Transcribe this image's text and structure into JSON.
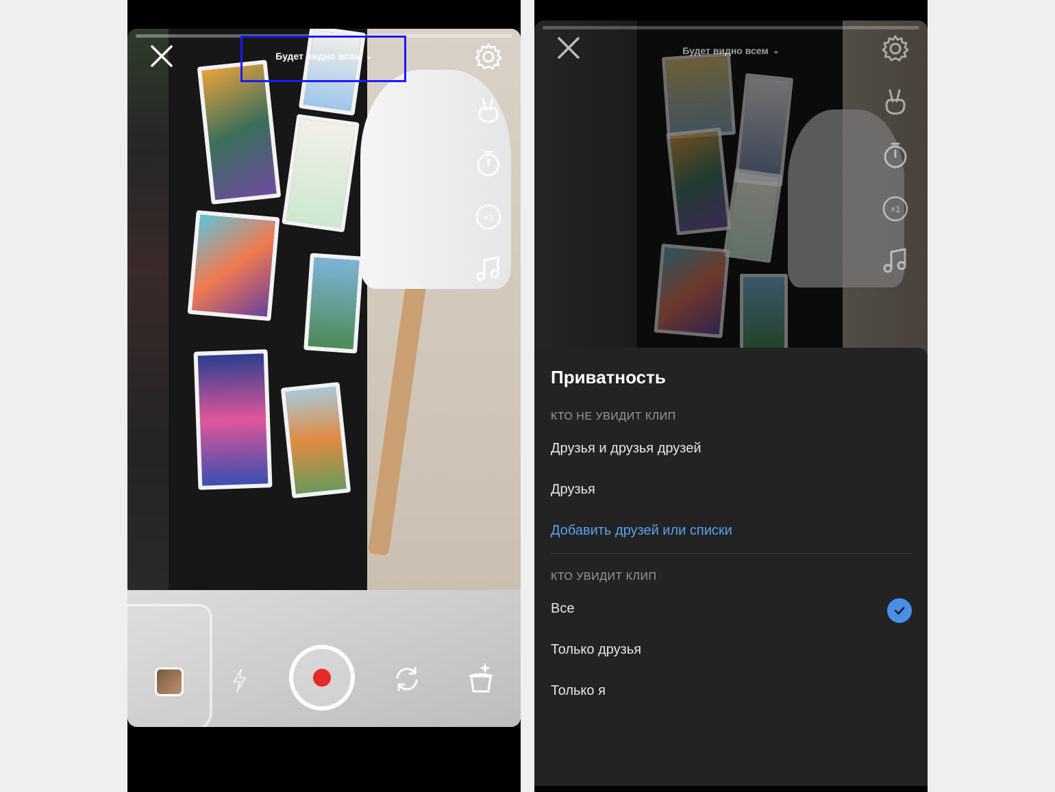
{
  "left": {
    "privacy_label": "Будет видно всем",
    "chevron": "⌄",
    "icons": [
      "close-icon",
      "settings-icon",
      "hand-icon",
      "timer-icon",
      "speed-icon",
      "music-icon",
      "flash-icon",
      "flip-camera-icon",
      "magic-hat-icon"
    ],
    "speed": "×1"
  },
  "right": {
    "privacy_label": "Будет видно всем",
    "chevron": "⌄",
    "speed": "×1",
    "sheet": {
      "title": "Приватность",
      "hidden_from_label": "КТО НЕ УВИДИТ КЛИП",
      "hidden_from_options": [
        "Друзья и друзья друзей",
        "Друзья"
      ],
      "add_link": "Добавить друзей или списки",
      "visible_to_label": "КТО УВИДИТ КЛИП",
      "visible_to_options": [
        "Все",
        "Только друзья",
        "Только я"
      ],
      "selected": "Все"
    },
    "accent": "#4a8fe7",
    "link_color": "#5aa2f0"
  },
  "record_color": "#e52a2a",
  "highlight_color": "#1a1aff"
}
